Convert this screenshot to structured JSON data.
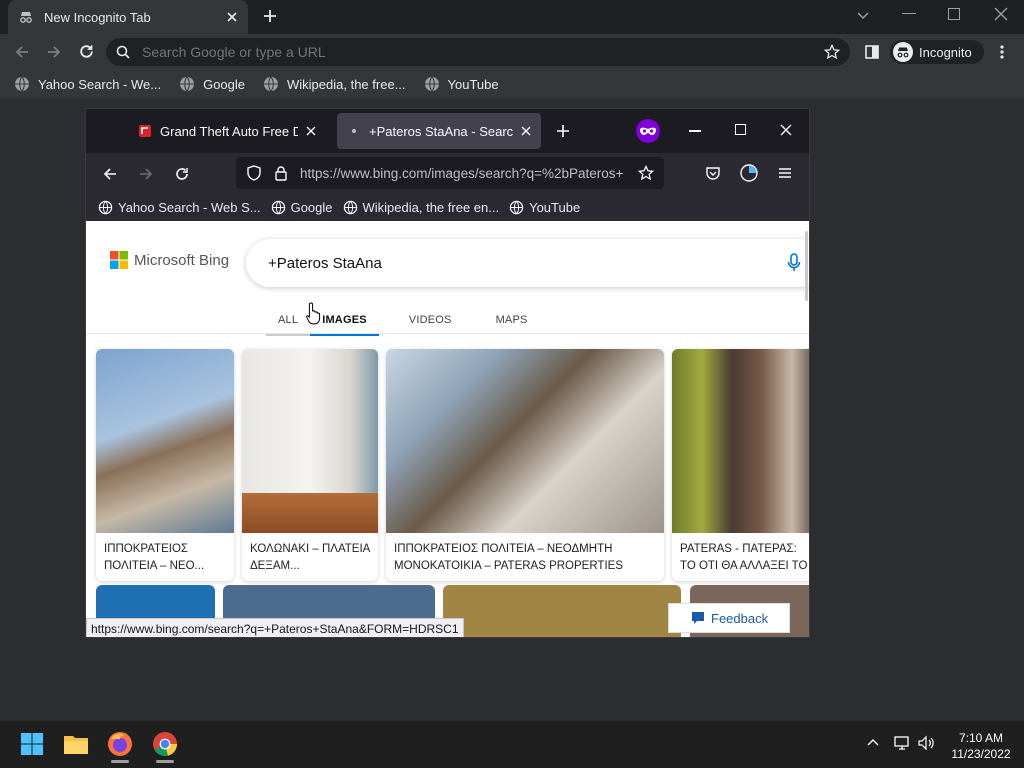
{
  "chrome": {
    "tab_title": "New Incognito Tab",
    "omnibox_placeholder": "Search Google or type a URL",
    "profile_label": "Incognito",
    "bookmarks": [
      "Yahoo Search - We...",
      "Google",
      "Wikipedia, the free...",
      "YouTube"
    ]
  },
  "firefox": {
    "tabs": [
      {
        "title": "Grand Theft Auto Free Down"
      },
      {
        "title": "+Pateros StaAna - Search Im"
      }
    ],
    "url": "https://www.bing.com/images/search?q=%2bPateros+",
    "bookmarks": [
      "Yahoo Search - Web S...",
      "Google",
      "Wikipedia, the free en...",
      "YouTube"
    ],
    "status_url": "https://www.bing.com/search?q=+Pateros+StaAna&FORM=HDRSC1"
  },
  "bing": {
    "logo_text": "Microsoft Bing",
    "query": "+Pateros StaAna",
    "nav": [
      "ALL",
      "IMAGES",
      "VIDEOS",
      "MAPS"
    ],
    "active_nav": "IMAGES",
    "results": [
      {
        "caption": "ΙΠΠΟΚΡΑΤΕΙΟΣ ΠΟΛΙΤΕΙΑ – ΝΕΟ..."
      },
      {
        "caption": "ΚΟΛΩΝΑΚΙ – ΠΛΑΤΕΙΑ ΔΕΞΑΜ..."
      },
      {
        "caption": "ΙΠΠΟΚΡΑΤΕΙΟΣ ΠΟΛΙΤΕΙΑ – ΝΕΟΔΜΗΤΗ ΜΟΝΟΚΑΤΟΙΚΙΑ – Pateras Properties"
      },
      {
        "caption": "PATERAS - ΠΑΤΕΡΑΣ: ΤΟ ΟΤΙ ΘΑ ΑΛΛΑΞΕΙ ΤΟ ..."
      }
    ],
    "feedback_label": "Feedback"
  },
  "taskbar": {
    "time": "7:10 AM",
    "date": "11/23/2022"
  },
  "colors": {
    "bing_accent": "#0078d4",
    "firefox_active_tab": "#42414d",
    "chrome_bg": "#2b2d30"
  }
}
